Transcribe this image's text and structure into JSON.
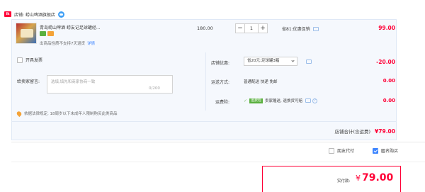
{
  "store": {
    "badge": "ik",
    "label": "店铺: 崂山啤酒旗舰店",
    "icon": "wangwang-chat-icon"
  },
  "item": {
    "title": "青岛崂山啤酒 崂友记足球罐经...",
    "note": "出商品性质不支持7天退货",
    "detail_link": "详情",
    "unit_price": "180.00",
    "quantity": "1",
    "qty_minus": "−",
    "qty_plus": "+",
    "promo": "省81:优惠促销",
    "subtotal": "99.00"
  },
  "invoice": {
    "label": "开具发票",
    "checked": false
  },
  "message": {
    "label": "给卖家留言:",
    "placeholder": "选填,填先和商家协商一致",
    "count": "0/200"
  },
  "notice": {
    "text": "依据法律规定, 18周岁以下未成年人限制购买此类商品"
  },
  "shop_discount": {
    "label": "店铺优惠:",
    "selected": "省20元:足球罐3箱",
    "value": "-20.00"
  },
  "shipping": {
    "label": "运送方式:",
    "text": "普通配送 快递 免邮",
    "value": "0.00"
  },
  "insurance": {
    "label": "运费险:",
    "check": "✓",
    "badge": "运费险",
    "text": "卖家赠送, 退换货可赔",
    "help": "?",
    "value": "0.00"
  },
  "shop_total": {
    "label": "店铺合计(含运费)",
    "amount": "¥79.00"
  },
  "options": {
    "friend_pay": "朋友代付",
    "anonymous": "匿名购买",
    "anonymous_checked": true
  },
  "payment": {
    "label": "实付款:",
    "currency": "¥",
    "amount": "79.00"
  },
  "colors": {
    "accent": "#ff0036",
    "panel_bg": "#f5f8fd",
    "link": "#3f86ff"
  }
}
